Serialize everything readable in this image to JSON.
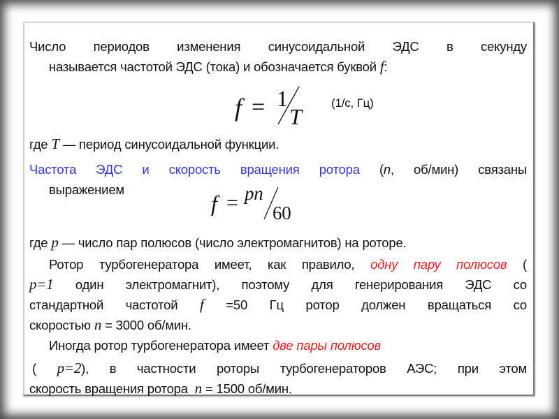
{
  "slide": {
    "para1": {
      "line1": "Число периодов изменения синусоидальной ЭДС в секунду",
      "line2_text": "называется частотой ЭДС (тока) и обозначается буквой",
      "line2_symbol": "f",
      "line2_end": ":"
    },
    "formula1": {
      "lhs": "f",
      "equals": "=",
      "numerator": "1",
      "denominator": "T",
      "units": "(1/с, Гц)"
    },
    "para2": {
      "prefix": "где",
      "symbol": "T",
      "text": "— период синусоидальной функции."
    },
    "para3": {
      "blue_text": "Частота ЭДС и скорость вращения ротора",
      "paren_open": "(",
      "symbol": "n",
      "paren_rest": ", об/мин) связаны",
      "line2": "выражением"
    },
    "formula2": {
      "lhs": "f",
      "equals": "=",
      "numerator": "pn",
      "denominator": "60"
    },
    "para4": {
      "prefix": "где",
      "symbol": "p",
      "text": "— число пар полюсов (число электромагнитов) на роторе."
    },
    "para5": {
      "line1_text": "Ротор турбогенератора имеет, как правило,",
      "line1_red": "одну пару полюсов",
      "line1_end": "(",
      "line2_symbol": "p=1",
      "line2_text": "один электромагнит), поэтому для генерирования ЭДС со",
      "line3_text": "стандартной частотой",
      "line3_symbol": "f",
      "line3_rest": "=50 Гц ротор должен вращаться со",
      "line4_text": "скоростью",
      "line4_symbol": "n",
      "line4_rest": "= 3000 об/мин."
    },
    "para6": {
      "line1_text": "Иногда ротор турбогенератора имеет",
      "line1_red": "две пары полюсов",
      "line2_open": "(",
      "line2_symbol": "p=2",
      "line2_text": "), в частности роторы турбогенераторов АЭС; при этом",
      "line3_text": "скорость вращения ротора",
      "line3_symbol": "n",
      "line3_rest": "= 1500 об/мин."
    },
    "colors": {
      "highlight_blue": "#3636d0",
      "highlight_red": "#e01e1e",
      "text": "#111111"
    }
  }
}
